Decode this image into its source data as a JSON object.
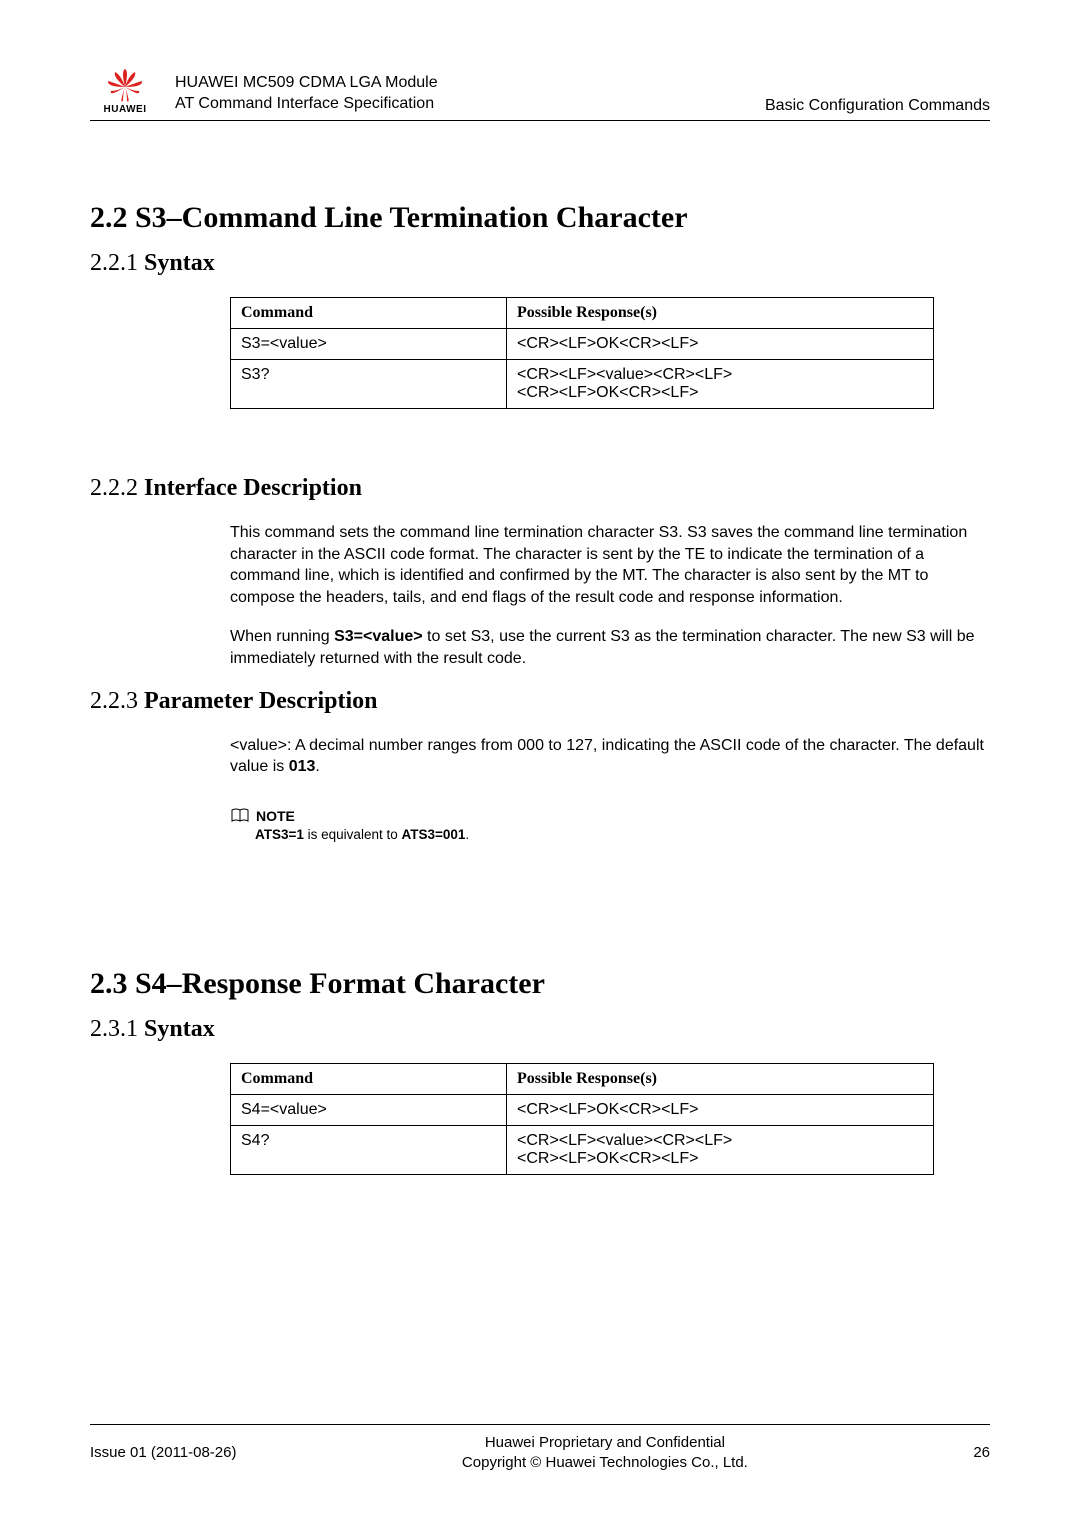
{
  "header": {
    "logo_label": "HUAWEI",
    "doc_title_line1": "HUAWEI MC509 CDMA LGA Module",
    "doc_title_line2": "AT Command Interface Specification",
    "chapter": "Basic Configuration Commands"
  },
  "section22": {
    "heading": "2.2 S3–Command Line Termination Character",
    "sub221": {
      "num": "2.2.1 ",
      "title": "Syntax",
      "table": {
        "th1": "Command",
        "th2": "Possible Response(s)",
        "r1c1": "S3=<value>",
        "r1c2": "<CR><LF>OK<CR><LF>",
        "r2c1": "S3?",
        "r2c2a": "<CR><LF><value><CR><LF>",
        "r2c2b": "<CR><LF>OK<CR><LF>"
      }
    },
    "sub222": {
      "num": "2.2.2 ",
      "title": "Interface Description",
      "p1": "This command sets the command line termination character S3. S3 saves the command line termination character in the ASCII code format. The character is sent by the TE to indicate the termination of a command line, which is identified and confirmed by the MT. The character is also sent by the MT to compose the headers, tails, and end flags of the result code and response information.",
      "p2_pre": "When running ",
      "p2_bold": "S3=<value>",
      "p2_post": " to set S3, use the current S3 as the termination character. The new S3 will be immediately returned with the result code."
    },
    "sub223": {
      "num": "2.2.3 ",
      "title": "Parameter Description",
      "p1_pre": "<value>: A decimal number ranges from 000 to 127, indicating the ASCII code of the character. The default value is ",
      "p1_bold": "013",
      "p1_post": ".",
      "note_label": "NOTE",
      "note_a": "ATS3=1",
      "note_mid": " is equivalent to ",
      "note_b": "ATS3=001",
      "note_end": "."
    }
  },
  "section23": {
    "heading": "2.3 S4–Response Format Character",
    "sub231": {
      "num": "2.3.1 ",
      "title": "Syntax",
      "table": {
        "th1": "Command",
        "th2": "Possible Response(s)",
        "r1c1": "S4=<value>",
        "r1c2": "<CR><LF>OK<CR><LF>",
        "r2c1": "S4?",
        "r2c2a": "<CR><LF><value><CR><LF>",
        "r2c2b": "<CR><LF>OK<CR><LF>"
      }
    }
  },
  "footer": {
    "left": "Issue 01 (2011-08-26)",
    "center1": "Huawei Proprietary and Confidential",
    "center2": "Copyright © Huawei Technologies Co., Ltd.",
    "right": "26"
  }
}
